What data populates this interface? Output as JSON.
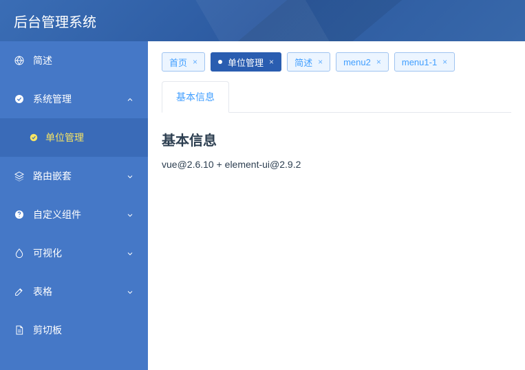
{
  "app": {
    "title": "后台管理系统"
  },
  "sidebar": {
    "items": [
      {
        "label": "简述",
        "expanded": false,
        "hasChildren": false
      },
      {
        "label": "系统管理",
        "expanded": true,
        "hasChildren": true,
        "children": [
          {
            "label": "单位管理",
            "active": true
          }
        ]
      },
      {
        "label": "路由嵌套",
        "expanded": false,
        "hasChildren": true
      },
      {
        "label": "自定义组件",
        "expanded": false,
        "hasChildren": true
      },
      {
        "label": "可视化",
        "expanded": false,
        "hasChildren": true
      },
      {
        "label": "表格",
        "expanded": false,
        "hasChildren": true
      },
      {
        "label": "剪切板",
        "expanded": false,
        "hasChildren": false
      }
    ]
  },
  "tags": [
    {
      "label": "首页",
      "active": false
    },
    {
      "label": "单位管理",
      "active": true
    },
    {
      "label": "简述",
      "active": false
    },
    {
      "label": "menu2",
      "active": false
    },
    {
      "label": "menu1-1",
      "active": false
    }
  ],
  "tabs": [
    {
      "label": "基本信息",
      "active": true
    }
  ],
  "content": {
    "heading": "基本信息",
    "body": "vue@2.6.10 + element-ui@2.9.2"
  }
}
